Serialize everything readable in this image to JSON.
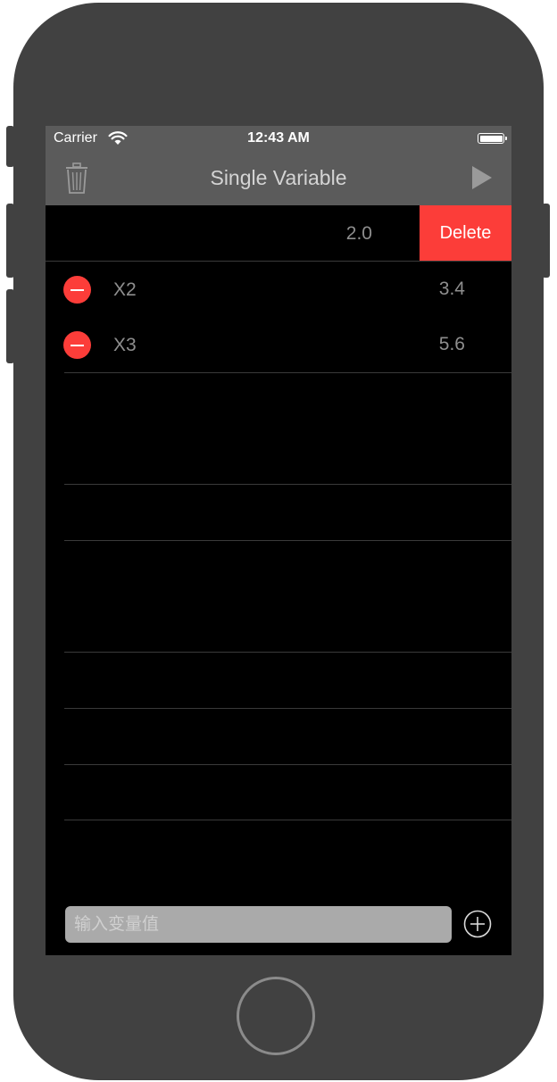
{
  "status_bar": {
    "carrier": "Carrier",
    "time": "12:43 AM",
    "wifi_icon": "wifi-icon",
    "battery_icon": "battery-icon"
  },
  "nav_bar": {
    "title": "Single Variable",
    "left_icon": "trash-icon",
    "right_icon": "play-icon"
  },
  "swiped_row": {
    "value": "2.0",
    "delete_label": "Delete"
  },
  "rows": [
    {
      "label": "X2",
      "value": "3.4"
    },
    {
      "label": "X3",
      "value": "5.6"
    }
  ],
  "input": {
    "placeholder": "输入变量值"
  },
  "add_icon": "plus-circle-icon",
  "colors": {
    "bar_bg": "#5b5b5b",
    "delete_red": "#fc3d39",
    "screen_bg": "#000000",
    "device_body": "#414141"
  }
}
